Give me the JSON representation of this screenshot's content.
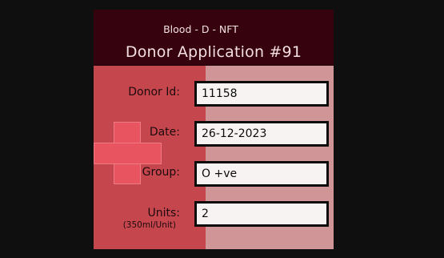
{
  "header": {
    "app_name": "Blood - D - NFT",
    "title": "Donor Application #91"
  },
  "form": {
    "donor_id": {
      "label": "Donor Id:",
      "value": "11158"
    },
    "date": {
      "label": "Date:",
      "value": "26-12-2023"
    },
    "group": {
      "label": "Group:",
      "value": "O +ve"
    },
    "units": {
      "label": "Units:",
      "sublabel": "(350ml/Unit)",
      "value": "2"
    }
  },
  "icons": {
    "cross": "medical-cross-icon"
  },
  "colors": {
    "page_background": "#0f0f0f",
    "header_background": "#36020d",
    "left_panel": "#c6464d",
    "right_panel": "#cf9597",
    "cross": "#e8545f",
    "field_background": "#f7f3f2"
  }
}
